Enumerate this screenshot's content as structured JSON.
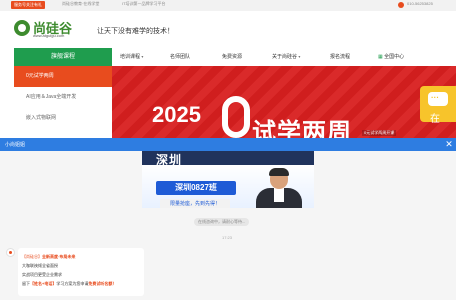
{
  "topbar": {
    "tag": "服务号关注有礼",
    "link1": "尚硅谷教育·在线学堂",
    "link2": "IT培训第一品牌学习平台",
    "phone": "010-56253825"
  },
  "header": {
    "logo_text": "尚硅谷",
    "logo_url": "www.atguigu.com",
    "slogan": "让天下没有难学的技术！"
  },
  "nav": {
    "category_label": "旗舰课程",
    "items": [
      "培训课程",
      "名师团队",
      "免费资源",
      "关于尚硅谷",
      "报名流程",
      "全国中心"
    ]
  },
  "left_menu": {
    "items": [
      "0元试学两周",
      "AI应用＆Java全端开发",
      "嵌入式物联网"
    ]
  },
  "banner": {
    "year": "2025",
    "headline": "试学两周",
    "sub": "0元试学两周开课"
  },
  "float_chat": {
    "label": "在"
  },
  "chat": {
    "title": "小尚姐姐",
    "poster": {
      "headline": "深圳",
      "class_name": "深圳0827班",
      "cta": "限量抢座，先到先得！"
    },
    "notice": "在线咨询中，请耐心等待...",
    "time": "17:23",
    "message": {
      "line1_prefix": "【尚硅谷】",
      "line1_highlight": "全新高度·布局未来",
      "line2": "大咖联袂倾全省面授",
      "line3": "实战项目更受企业需求",
      "line4_prefix": "留下",
      "line4_highlight": "【姓名+电话】",
      "line4_mid": "学习方案为您申请",
      "line4_end": "免费试听名额！"
    }
  },
  "colors": {
    "brand_green": "#1f9d4e",
    "accent_red": "#e84c1e",
    "banner_red": "#d81f1f",
    "chat_blue": "#2e7de1"
  }
}
